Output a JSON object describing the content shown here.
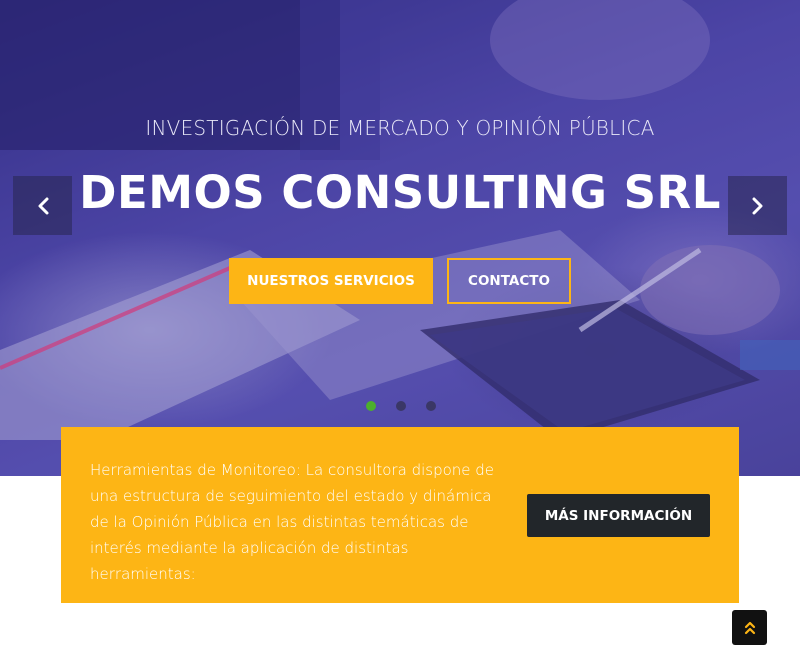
{
  "hero": {
    "subtitle": "INVESTIGACIÓN DE MERCADO Y OPINIÓN PÚBLICA",
    "title": "DEMOS CONSULTING SRL",
    "buttons": {
      "services_label": "NUESTROS SERVICIOS",
      "contact_label": "CONTACTO"
    },
    "carousel": {
      "prev_icon": "chevron-left-icon",
      "next_icon": "chevron-right-icon",
      "slides": 3,
      "active_slide": 1
    }
  },
  "info_card": {
    "text": "Herramientas de Monitoreo: La consultora dispone de una estructura de seguimiento del estado y dinámica de la Opinión Pública en las distintas temáticas de interés mediante la aplicación de distintas herramientas:",
    "button_label": "MÁS INFORMACIÓN"
  },
  "scroll_top": {
    "icon": "double-chevron-up-icon"
  },
  "colors": {
    "accent": "#fdb515",
    "dark_button": "#22262a",
    "hero_overlay": "#4e48a4",
    "active_dot": "#4caf2c"
  }
}
